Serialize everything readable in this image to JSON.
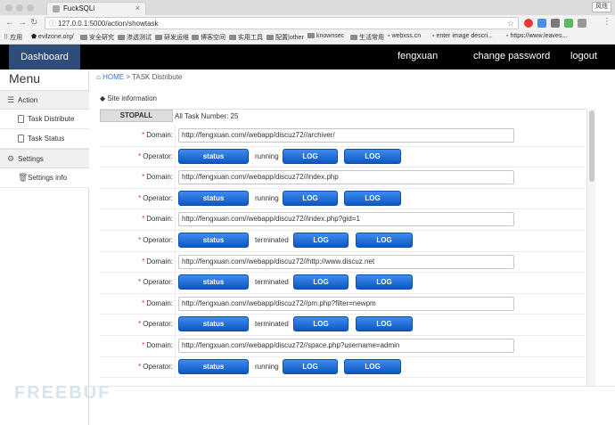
{
  "browser": {
    "tab_title": "FuckSQLi",
    "tab_close": "×",
    "url": "127.0.0.1:5000/action/showtask",
    "user_label": "风炫",
    "bookmarks": [
      "应用",
      "evilzone.org/",
      "安全研究",
      "渗透测试",
      "研发运维",
      "博客空间",
      "实用工具",
      "配置|other",
      "knownsec",
      "生活常用",
      "webxss.cn",
      "enter image descri...",
      "https://www.leaves..."
    ]
  },
  "nav": {
    "brand": "Dashboard",
    "user": "fengxuan",
    "change_password": "change password",
    "logout": "logout"
  },
  "sidebar": {
    "title": "Menu",
    "sections": [
      {
        "label": "Action",
        "items": [
          "Task Distribute",
          "Task Status"
        ]
      },
      {
        "label": "Settings",
        "items": [
          "Settings info"
        ]
      }
    ]
  },
  "breadcrumb": {
    "home": "HOME",
    "sep": ">",
    "current": "TASK Distribute"
  },
  "site_info_label": "Site information",
  "stopall_label": "STOPALL",
  "task_count_label": "All Task Number: 25",
  "labels": {
    "domain": "Domain:",
    "operator": "Operator:",
    "required_mark": "*"
  },
  "buttons": {
    "status": "status",
    "log": "LOG"
  },
  "tasks": [
    {
      "domain": "http://fengxuan.com//webapp/discuz72//archiver/",
      "state": "running"
    },
    {
      "domain": "http://fengxuan.com//webapp/discuz72//index.php",
      "state": "running"
    },
    {
      "domain": "http://fengxuan.com//webapp/discuz72//index.php?gid=1",
      "state": "terminated"
    },
    {
      "domain": "http://fengxuan.com//webapp/discuz72//http://www.discuz.net",
      "state": "terminated"
    },
    {
      "domain": "http://fengxuan.com//webapp/discuz72//pm.php?filter=newpm",
      "state": "terminated"
    },
    {
      "domain": "http://fengxuan.com//webapp/discuz72//space.php?username=admin",
      "state": "running"
    }
  ]
}
